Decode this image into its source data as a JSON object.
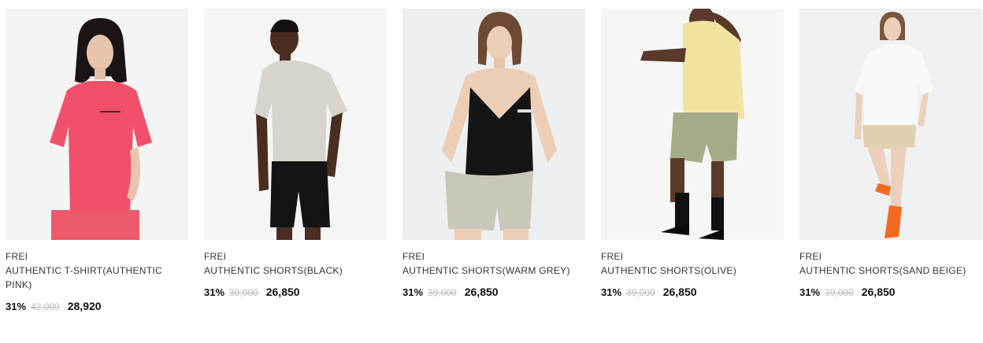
{
  "products": [
    {
      "brand": "FREI",
      "name": "AUTHENTIC T-SHIRT(AUTHENTIC PINK)",
      "discount": "31%",
      "original_price": "42,000",
      "sale_price": "28,920",
      "bg_color": "#f4f4f4",
      "top_color": "#f0506a",
      "bottom_color": "#ec5a6c",
      "image_name": "model-pink-tshirt-photo"
    },
    {
      "brand": "FREI",
      "name": "AUTHENTIC SHORTS(BLACK)",
      "discount": "31%",
      "original_price": "39,000",
      "sale_price": "26,850",
      "bg_color": "#f5f5f5",
      "top_color": "#d6d4cc",
      "bottom_color": "#141414",
      "image_name": "model-black-shorts-photo"
    },
    {
      "brand": "FREI",
      "name": "AUTHENTIC SHORTS(WARM GREY)",
      "discount": "31%",
      "original_price": "39,000",
      "sale_price": "26,850",
      "bg_color": "#eceeef",
      "top_color": "#151515",
      "bottom_color": "#c9c6ba",
      "image_name": "model-warm-grey-shorts-photo"
    },
    {
      "brand": "FREI",
      "name": "AUTHENTIC SHORTS(OLIVE)",
      "discount": "31%",
      "original_price": "39,000",
      "sale_price": "26,850",
      "bg_color": "#f6f6f5",
      "top_color": "#f3e3a0",
      "bottom_color": "#a3ab88",
      "image_name": "model-olive-shorts-photo"
    },
    {
      "brand": "FREI",
      "name": "AUTHENTIC SHORTS(SAND BEIGE)",
      "discount": "31%",
      "original_price": "39,000",
      "sale_price": "26,850",
      "bg_color": "#eef0f1",
      "top_color": "#f7f8f8",
      "bottom_color": "#ddd1b0",
      "image_name": "model-sand-beige-shorts-photo"
    }
  ]
}
